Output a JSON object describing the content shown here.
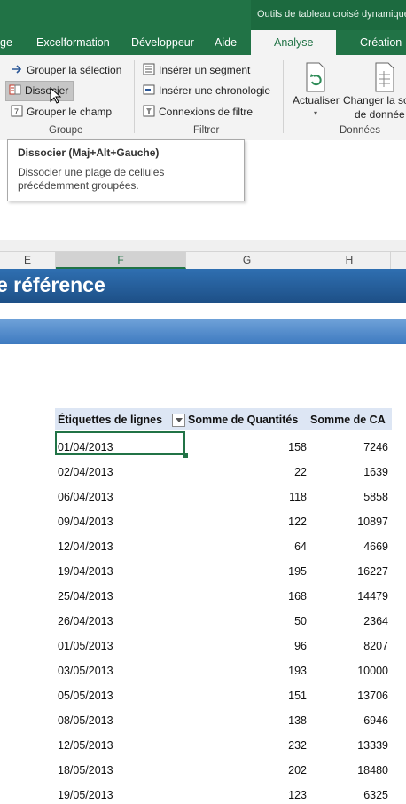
{
  "context_title": "Outils de tableau croisé dynamique",
  "tabs": [
    {
      "label": "ge"
    },
    {
      "label": "Excelformation"
    },
    {
      "label": "Développeur"
    },
    {
      "label": "Aide"
    },
    {
      "label": "Analyse"
    },
    {
      "label": "Création"
    }
  ],
  "ribbon": {
    "groupe": {
      "grouper_selection": "Grouper la sélection",
      "dissocier": "Dissocier",
      "grouper_champ": "Grouper le champ",
      "label": "Groupe"
    },
    "filtrer": {
      "inserer_segment": "Insérer un segment",
      "inserer_chronologie": "Insérer une chronologie",
      "connexions_filtre": "Connexions de filtre",
      "label": "Filtrer"
    },
    "donnees": {
      "actualiser": "Actualiser",
      "changer_line1": "Changer la so",
      "changer_line2": "de donnée",
      "label": "Données"
    }
  },
  "tooltip": {
    "title": "Dissocier (Maj+Alt+Gauche)",
    "description": "Dissocier une plage de cellules précédemment groupées."
  },
  "columns": [
    "E",
    "F",
    "G",
    "H"
  ],
  "banner_text": "e référence",
  "pivot": {
    "headers": {
      "rows": "Étiquettes de lignes",
      "quantities": "Somme de Quantités",
      "ca": "Somme de CA"
    },
    "rows": [
      {
        "date": "01/04/2013",
        "q": "158",
        "ca": "7246"
      },
      {
        "date": "02/04/2013",
        "q": "22",
        "ca": "1639"
      },
      {
        "date": "06/04/2013",
        "q": "118",
        "ca": "5858"
      },
      {
        "date": "09/04/2013",
        "q": "122",
        "ca": "10897"
      },
      {
        "date": "12/04/2013",
        "q": "64",
        "ca": "4669"
      },
      {
        "date": "19/04/2013",
        "q": "195",
        "ca": "16227"
      },
      {
        "date": "25/04/2013",
        "q": "168",
        "ca": "14479"
      },
      {
        "date": "26/04/2013",
        "q": "50",
        "ca": "2364"
      },
      {
        "date": "01/05/2013",
        "q": "96",
        "ca": "8207"
      },
      {
        "date": "03/05/2013",
        "q": "193",
        "ca": "10000"
      },
      {
        "date": "05/05/2013",
        "q": "151",
        "ca": "13706"
      },
      {
        "date": "08/05/2013",
        "q": "138",
        "ca": "6946"
      },
      {
        "date": "12/05/2013",
        "q": "232",
        "ca": "13339"
      },
      {
        "date": "18/05/2013",
        "q": "202",
        "ca": "18480"
      },
      {
        "date": "19/05/2013",
        "q": "123",
        "ca": "6325"
      }
    ]
  },
  "colors": {
    "excel_green": "#217346",
    "banner_blue": "#1d4f86",
    "pivot_header_bg": "#dde6f4"
  }
}
